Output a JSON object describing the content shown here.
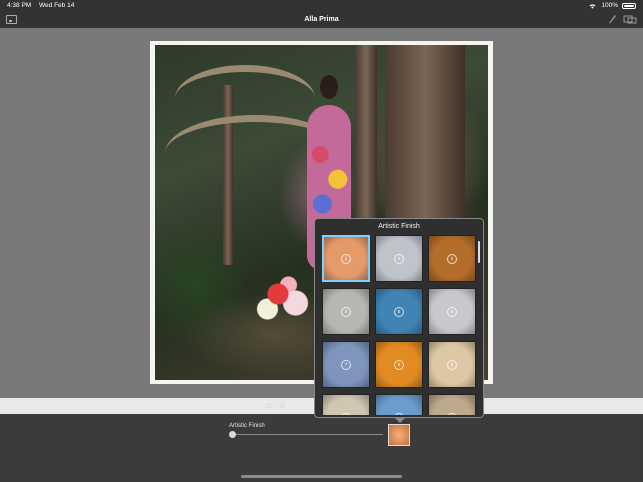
{
  "status": {
    "time": "4:38 PM",
    "date": "Wed Feb 14",
    "battery": "100%"
  },
  "nav": {
    "title": "Alla Prima"
  },
  "popover": {
    "title": "Artistic Finish",
    "finishes": [
      {
        "number": "1",
        "color": "#e59a6a",
        "selected": true
      },
      {
        "number": "2",
        "color": "#bfc3cc",
        "selected": false
      },
      {
        "number": "3",
        "color": "#b46d2a",
        "selected": false
      },
      {
        "number": "4",
        "color": "#b7b6b0",
        "selected": false
      },
      {
        "number": "5",
        "color": "#3f84b5",
        "selected": false
      },
      {
        "number": "6",
        "color": "#c7c8cd",
        "selected": false
      },
      {
        "number": "7",
        "color": "#7f95bd",
        "selected": false
      },
      {
        "number": "8",
        "color": "#e28b22",
        "selected": false
      },
      {
        "number": "9",
        "color": "#dcc8a4",
        "selected": false
      },
      {
        "number": "10",
        "color": "#d1c6b2",
        "selected": false
      },
      {
        "number": "11",
        "color": "#6b9ccc",
        "selected": false
      },
      {
        "number": "12",
        "color": "#bca98e",
        "selected": false
      }
    ]
  },
  "bottom": {
    "slider_label": "Artistic Finish",
    "slider_value": 0.0
  }
}
